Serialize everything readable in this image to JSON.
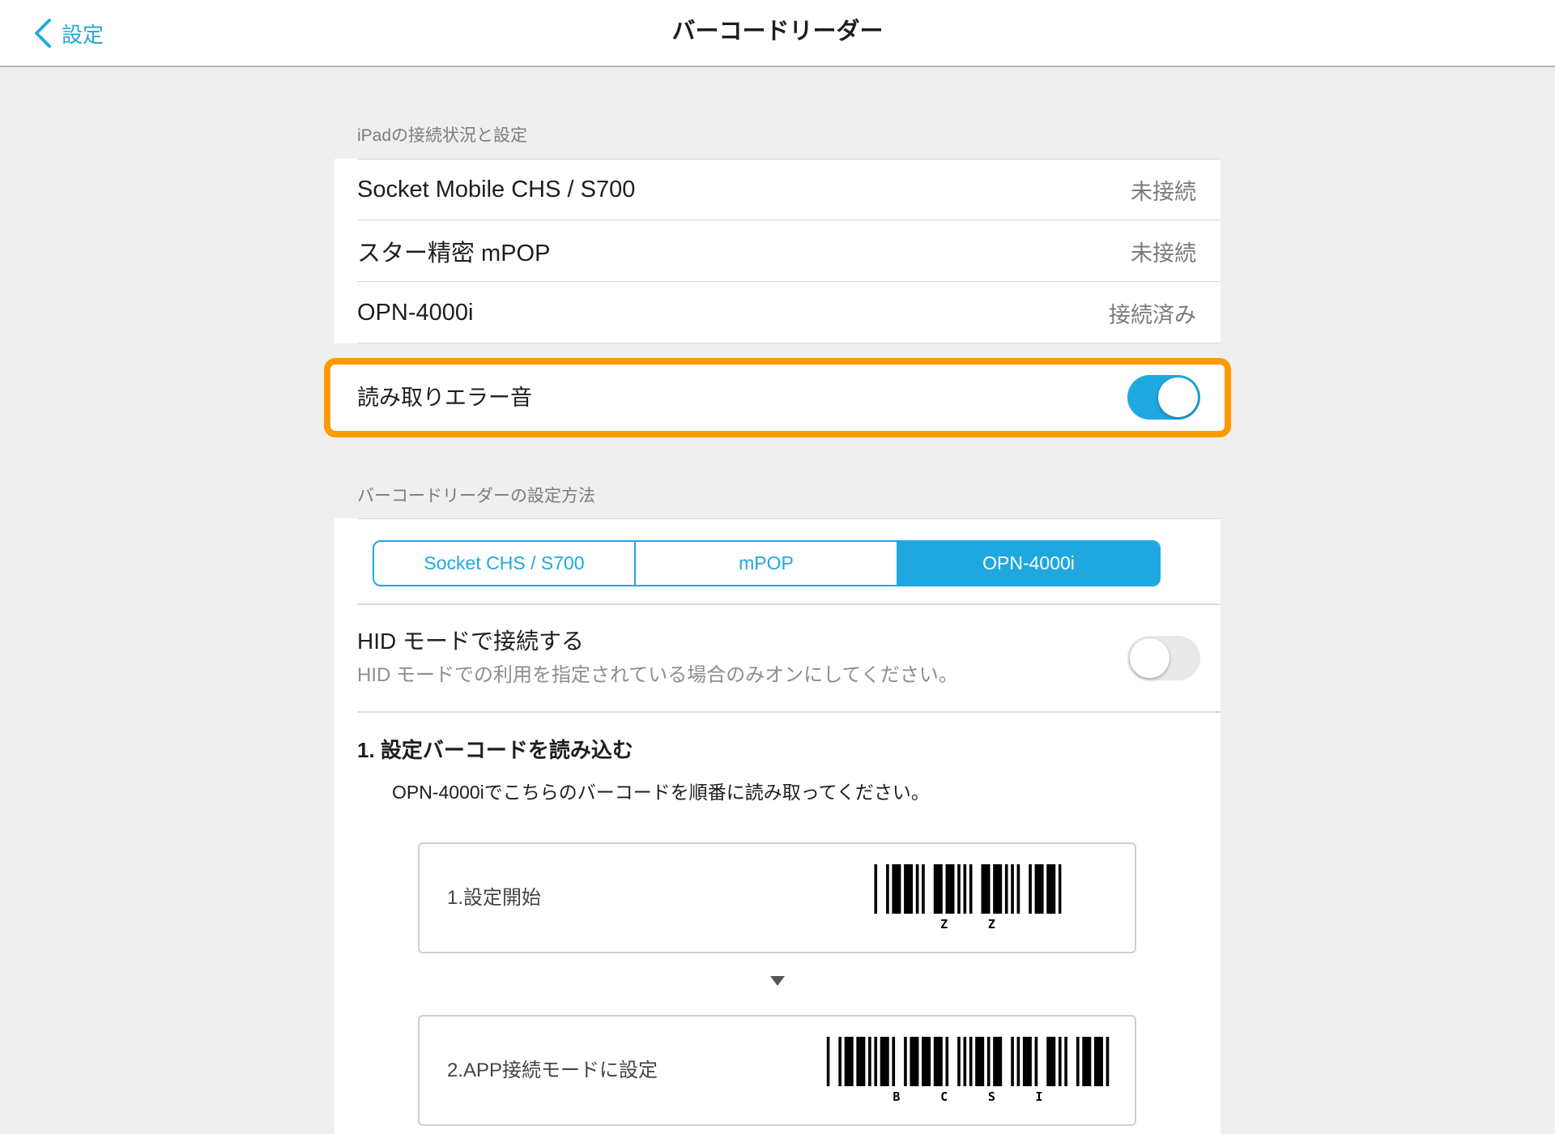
{
  "nav": {
    "back_label": "設定",
    "title": "バーコードリーダー",
    "back_icon": "chevron-left-icon"
  },
  "colors": {
    "accent": "#1fa8e0",
    "highlight": "#ff9900",
    "background": "#efefef"
  },
  "connection_section": {
    "header": "iPadの接続状況と設定",
    "devices": [
      {
        "name": "Socket Mobile CHS / S700",
        "status": "未接続"
      },
      {
        "name": "スター精密 mPOP",
        "status": "未接続"
      },
      {
        "name": "OPN-4000i",
        "status": "接続済み"
      }
    ],
    "error_sound": {
      "label": "読み取りエラー音",
      "enabled": true
    }
  },
  "setup_section": {
    "header": "バーコードリーダーの設定方法",
    "tabs": [
      {
        "label": "Socket CHS / S700",
        "selected": false
      },
      {
        "label": "mPOP",
        "selected": false
      },
      {
        "label": "OPN-4000i",
        "selected": true
      }
    ],
    "hid_mode": {
      "title": "HID モードで接続する",
      "description": "HID モードでの利用を指定されている場合のみオンにしてください。",
      "enabled": false
    },
    "step1": {
      "heading": "1. 設定バーコードを読み込む",
      "instruction": "OPN-4000iでこちらのバーコードを順番に読み取ってください。",
      "arrow_icon": "down-triangle-icon",
      "barcodes": [
        {
          "label": "1.設定開始",
          "chars": [
            "Z",
            "Z"
          ]
        },
        {
          "label": "2.APP接続モードに設定",
          "chars": [
            "B",
            "C",
            "S",
            "I"
          ]
        }
      ]
    }
  }
}
